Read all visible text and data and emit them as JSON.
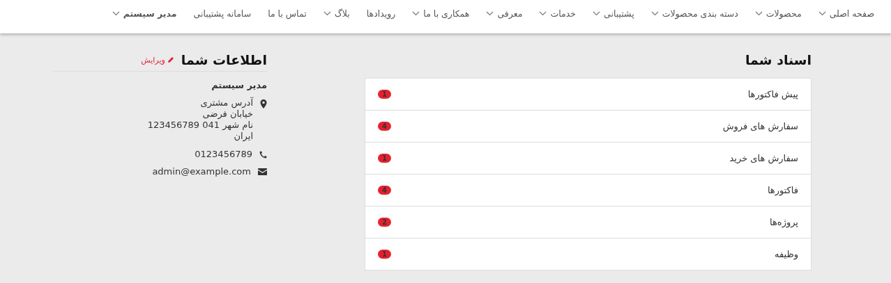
{
  "nav": [
    {
      "label": "صفحه اصلی",
      "dropdown": true
    },
    {
      "label": "محصولات",
      "dropdown": true
    },
    {
      "label": "دسته بندی محصولات",
      "dropdown": true
    },
    {
      "label": "پشتیبانی",
      "dropdown": true
    },
    {
      "label": "خدمات",
      "dropdown": true
    },
    {
      "label": "معرفی",
      "dropdown": true
    },
    {
      "label": "همکاری با ما",
      "dropdown": true
    },
    {
      "label": "رویدادها",
      "dropdown": false
    },
    {
      "label": "بلاگ",
      "dropdown": true
    },
    {
      "label": "تماس با ما",
      "dropdown": false
    },
    {
      "label": "سامانه پشتیبانی",
      "dropdown": false
    },
    {
      "label": "مدیر سیستم",
      "dropdown": true,
      "bold": true
    }
  ],
  "documents": {
    "title": "اسناد شما",
    "items": [
      {
        "label": "پیش فاکتورها",
        "count": "1"
      },
      {
        "label": "سفارش های فروش",
        "count": "4"
      },
      {
        "label": "سفارش های خرید",
        "count": "1"
      },
      {
        "label": "فاکتورها",
        "count": "4"
      },
      {
        "label": "پروژه‌ها",
        "count": "2"
      },
      {
        "label": "وظیفه",
        "count": "1"
      }
    ]
  },
  "info": {
    "title": "اطلاعات شما",
    "edit": "ویرایش",
    "name": "مدیر سیستم",
    "address": [
      "آدرس مشتری",
      "خیابان فرضی",
      "نام شهر 041 123456789",
      "ایران"
    ],
    "phone": "0123456789",
    "email": "admin@example.com"
  }
}
